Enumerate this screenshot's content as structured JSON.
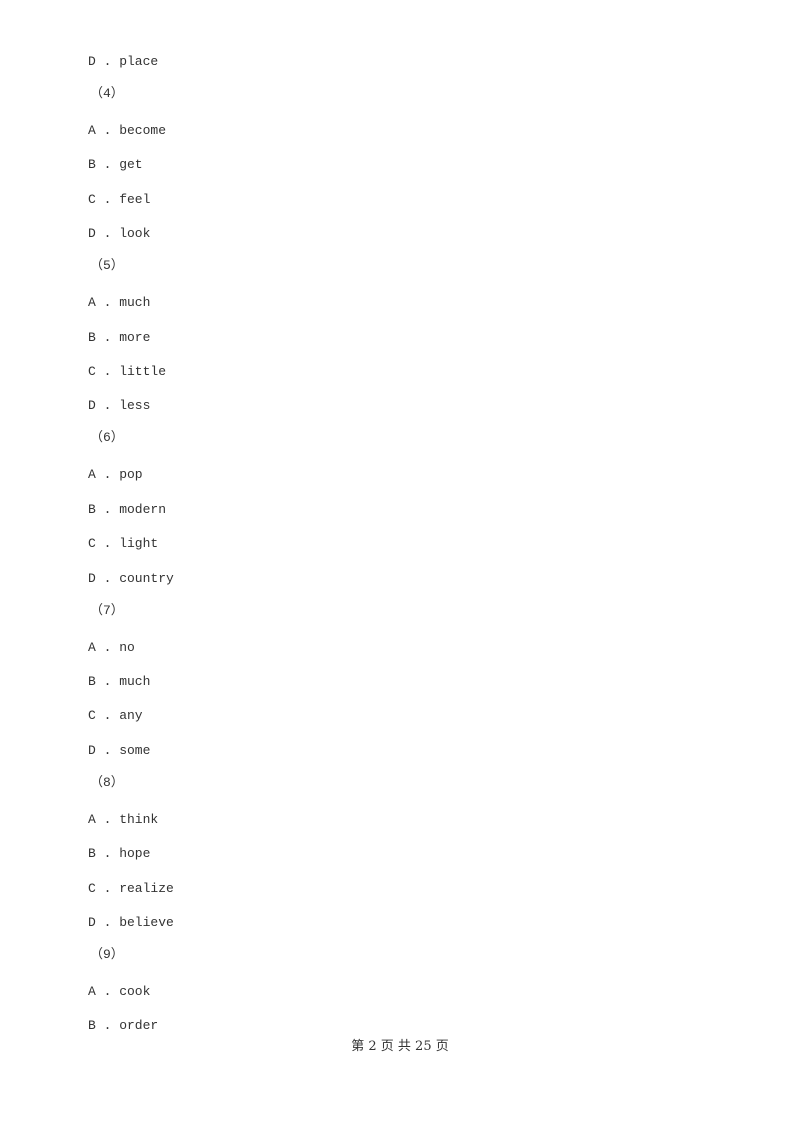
{
  "lines": [
    {
      "type": "option",
      "text": "D . place"
    },
    {
      "type": "question",
      "text": "（4）"
    },
    {
      "type": "option",
      "text": "A . become"
    },
    {
      "type": "option",
      "text": "B . get"
    },
    {
      "type": "option",
      "text": "C . feel"
    },
    {
      "type": "option",
      "text": "D . look"
    },
    {
      "type": "question",
      "text": "（5）"
    },
    {
      "type": "option",
      "text": "A . much"
    },
    {
      "type": "option",
      "text": "B . more"
    },
    {
      "type": "option",
      "text": "C . little"
    },
    {
      "type": "option",
      "text": "D . less"
    },
    {
      "type": "question",
      "text": "（6）"
    },
    {
      "type": "option",
      "text": "A . pop"
    },
    {
      "type": "option",
      "text": "B . modern"
    },
    {
      "type": "option",
      "text": "C . light"
    },
    {
      "type": "option",
      "text": "D . country"
    },
    {
      "type": "question",
      "text": "（7）"
    },
    {
      "type": "option",
      "text": "A . no"
    },
    {
      "type": "option",
      "text": "B . much"
    },
    {
      "type": "option",
      "text": "C . any"
    },
    {
      "type": "option",
      "text": "D . some"
    },
    {
      "type": "question",
      "text": "（8）"
    },
    {
      "type": "option",
      "text": "A . think"
    },
    {
      "type": "option",
      "text": "B . hope"
    },
    {
      "type": "option",
      "text": "C . realize"
    },
    {
      "type": "option",
      "text": "D . believe"
    },
    {
      "type": "question",
      "text": "（9）"
    },
    {
      "type": "option",
      "text": "A . cook"
    },
    {
      "type": "option",
      "text": "B . order"
    }
  ],
  "footer": "第 2 页 共 25 页"
}
